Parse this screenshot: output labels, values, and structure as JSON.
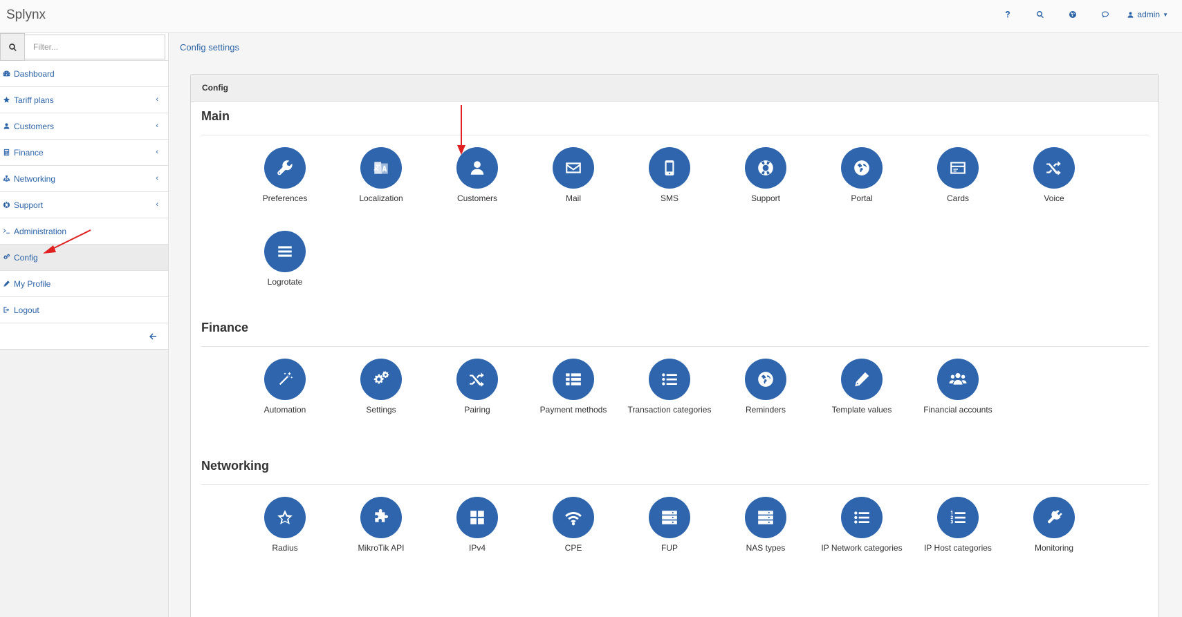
{
  "app": {
    "brand": "Splynx"
  },
  "topbar": {
    "help_icon": "question-icon",
    "search_icon": "search-icon",
    "globe_icon": "globe-icon",
    "chat_icon": "comment-icon",
    "user_label": "admin"
  },
  "sidebar": {
    "filter_placeholder": "Filter...",
    "items": [
      {
        "label": "Dashboard",
        "icon": "dashboard-icon",
        "has_submenu": false
      },
      {
        "label": "Tariff plans",
        "icon": "star-icon",
        "has_submenu": true
      },
      {
        "label": "Customers",
        "icon": "user-icon",
        "has_submenu": true
      },
      {
        "label": "Finance",
        "icon": "calculator-icon",
        "has_submenu": true
      },
      {
        "label": "Networking",
        "icon": "sitemap-icon",
        "has_submenu": true
      },
      {
        "label": "Support",
        "icon": "lifebuoy-icon",
        "has_submenu": true
      },
      {
        "label": "Administration",
        "icon": "terminal-icon",
        "has_submenu": false
      },
      {
        "label": "Config",
        "icon": "gears-icon",
        "has_submenu": false,
        "active": true
      },
      {
        "label": "My Profile",
        "icon": "pencil-icon",
        "has_submenu": false
      },
      {
        "label": "Logout",
        "icon": "sign-out-icon",
        "has_submenu": false
      }
    ],
    "collapse_icon": "arrow-left-icon"
  },
  "breadcrumb": "Config settings",
  "panel": {
    "title": "Config",
    "sections": [
      {
        "title": "Main",
        "tiles": [
          {
            "label": "Preferences",
            "icon": "wrench-icon"
          },
          {
            "label": "Localization",
            "icon": "translate-icon"
          },
          {
            "label": "Customers",
            "icon": "user-icon"
          },
          {
            "label": "Mail",
            "icon": "envelope-icon"
          },
          {
            "label": "SMS",
            "icon": "mobile-icon"
          },
          {
            "label": "Support",
            "icon": "lifebuoy-icon"
          },
          {
            "label": "Portal",
            "icon": "globe-icon"
          },
          {
            "label": "Cards",
            "icon": "credit-card-icon"
          },
          {
            "label": "Voice",
            "icon": "random-icon"
          },
          {
            "label": "Logrotate",
            "icon": "bars-icon"
          }
        ]
      },
      {
        "title": "Finance",
        "tiles": [
          {
            "label": "Automation",
            "icon": "magic-icon"
          },
          {
            "label": "Settings",
            "icon": "gears-icon"
          },
          {
            "label": "Pairing",
            "icon": "random-icon"
          },
          {
            "label": "Payment methods",
            "icon": "th-list-icon"
          },
          {
            "label": "Transaction categories",
            "icon": "list-icon"
          },
          {
            "label": "Reminders",
            "icon": "globe-icon"
          },
          {
            "label": "Template values",
            "icon": "pencil-icon"
          },
          {
            "label": "Financial accounts",
            "icon": "users-icon"
          }
        ]
      },
      {
        "title": "Networking",
        "tiles": [
          {
            "label": "Radius",
            "icon": "star-outline-icon"
          },
          {
            "label": "MikroTik API",
            "icon": "puzzle-icon"
          },
          {
            "label": "IPv4",
            "icon": "th-large-icon"
          },
          {
            "label": "CPE",
            "icon": "wifi-icon"
          },
          {
            "label": "FUP",
            "icon": "server-icon"
          },
          {
            "label": "NAS types",
            "icon": "server-icon"
          },
          {
            "label": "IP Network categories",
            "icon": "list-icon"
          },
          {
            "label": "IP Host categories",
            "icon": "list-ol-icon"
          },
          {
            "label": "Monitoring",
            "icon": "plug-icon"
          }
        ]
      }
    ]
  },
  "colors": {
    "accent": "#2e65ad",
    "link": "#2d64a8",
    "annotation": "#e02020"
  }
}
